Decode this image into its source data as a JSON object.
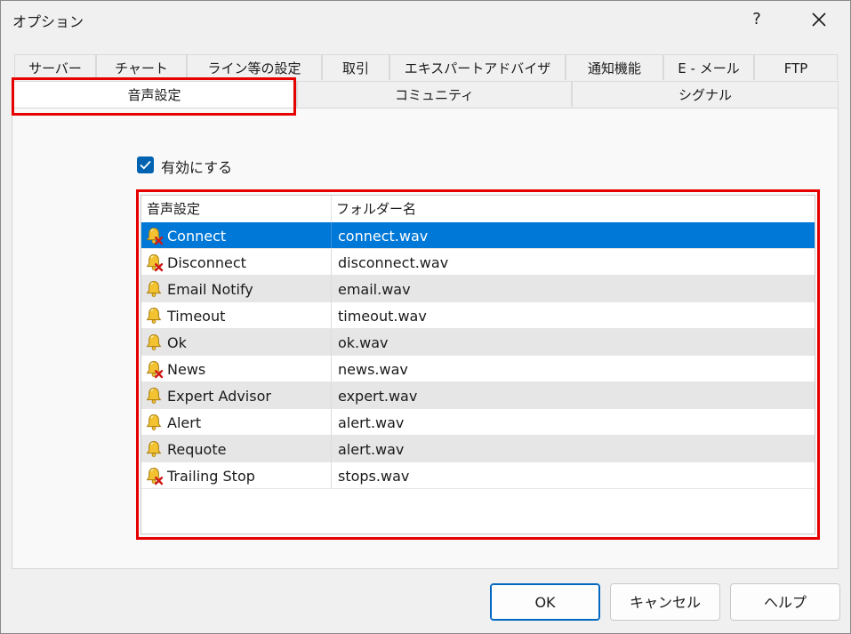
{
  "window": {
    "title": "オプション",
    "help": "?"
  },
  "tabs_row1": [
    "サーバー",
    "チャート",
    "ライン等の設定",
    "取引",
    "エキスパートアドバイザ",
    "通知機能",
    "E - メール",
    "FTP"
  ],
  "tabs_row2": [
    "音声設定",
    "コミュニティ",
    "シグナル"
  ],
  "active_tab": "音声設定",
  "enable_checkbox": {
    "label": "有効にする",
    "checked": true
  },
  "sound_list": {
    "columns": [
      "音声設定",
      "フォルダー名"
    ],
    "rows": [
      {
        "event": "Connect",
        "file": "connect.wav",
        "enabled": false
      },
      {
        "event": "Disconnect",
        "file": "disconnect.wav",
        "enabled": false
      },
      {
        "event": "Email Notify",
        "file": "email.wav",
        "enabled": true
      },
      {
        "event": "Timeout",
        "file": "timeout.wav",
        "enabled": true
      },
      {
        "event": "Ok",
        "file": "ok.wav",
        "enabled": true
      },
      {
        "event": "News",
        "file": "news.wav",
        "enabled": false
      },
      {
        "event": "Expert Advisor",
        "file": "expert.wav",
        "enabled": true
      },
      {
        "event": "Alert",
        "file": "alert.wav",
        "enabled": true
      },
      {
        "event": "Requote",
        "file": "alert.wav",
        "enabled": true
      },
      {
        "event": "Trailing Stop",
        "file": "stops.wav",
        "enabled": false
      }
    ],
    "selected_row": 0
  },
  "buttons": {
    "ok": "OK",
    "cancel": "キャンセル",
    "help": "ヘルプ"
  },
  "colors": {
    "accent": "#0078d7",
    "highlight": "#e60000",
    "bell": "#f2c230",
    "disabled_mark": "#d01818"
  },
  "icons": {
    "row_icon": "bell-icon",
    "disabled_overlay": "red-x-icon",
    "close": "close-icon",
    "checkmark": "checkmark-icon"
  }
}
